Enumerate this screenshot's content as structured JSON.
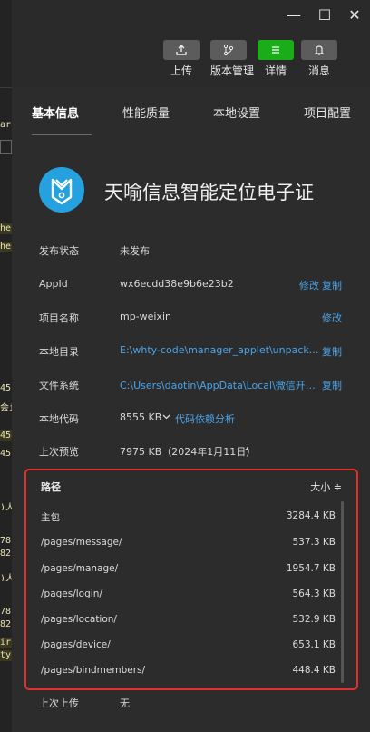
{
  "window": {
    "minimize": "—",
    "maximize": "☐",
    "close": "✕"
  },
  "toolbar": {
    "upload": "上传",
    "version": "版本管理",
    "details": "详情",
    "messages": "消息"
  },
  "tabs": [
    "基本信息",
    "性能质量",
    "本地设置",
    "项目配置"
  ],
  "app": {
    "name": "天喻信息智能定位电子证"
  },
  "info": {
    "publish_status": {
      "label": "发布状态",
      "value": "未发布"
    },
    "appid": {
      "label": "AppId",
      "value": "wx6ecdd38e9b6e23b2",
      "edit": "修改",
      "copy": "复制"
    },
    "project_name": {
      "label": "项目名称",
      "value": "mp-weixin",
      "edit": "修改"
    },
    "local_dir": {
      "label": "本地目录",
      "value": "E:\\whty-code\\manager_applet\\unpackage\\dist\\dev\\mp-weixin",
      "copy": "复制"
    },
    "file_system": {
      "label": "文件系统",
      "value": "C:\\Users\\daotin\\AppData\\Local\\微信开发者工具\\User Data",
      "copy": "复制"
    },
    "local_code": {
      "label": "本地代码",
      "value": "8555 KB",
      "link": "代码依赖分析"
    },
    "last_preview": {
      "label": "上次预览",
      "value": "7975 KB（2024年1月11日）"
    },
    "last_upload": {
      "label": "上次上传",
      "value": "无"
    }
  },
  "packages": {
    "col_path": "路径",
    "col_size": "大小 ≑",
    "rows": [
      {
        "path": "主包",
        "size": "3284.4 KB"
      },
      {
        "path": "/pages/message/",
        "size": "537.3 KB"
      },
      {
        "path": "/pages/manage/",
        "size": "1954.7 KB"
      },
      {
        "path": "/pages/login/",
        "size": "564.3 KB"
      },
      {
        "path": "/pages/location/",
        "size": "532.9 KB"
      },
      {
        "path": "/pages/device/",
        "size": "653.1 KB"
      },
      {
        "path": "/pages/bindmembers/",
        "size": "448.4 KB"
      }
    ]
  },
  "left_strip": [
    "ar",
    "he",
    "he",
    "45",
    "会i",
    "45",
    "45",
    ")人",
    "78",
    "82",
    ")人",
    "78",
    "82",
    "ir",
    "ty"
  ],
  "colors": {
    "accent_green": "#1aad19",
    "link_blue": "#4aa3e8",
    "highlight_red": "#e0312b",
    "logo_blue": "#26a1e0"
  }
}
